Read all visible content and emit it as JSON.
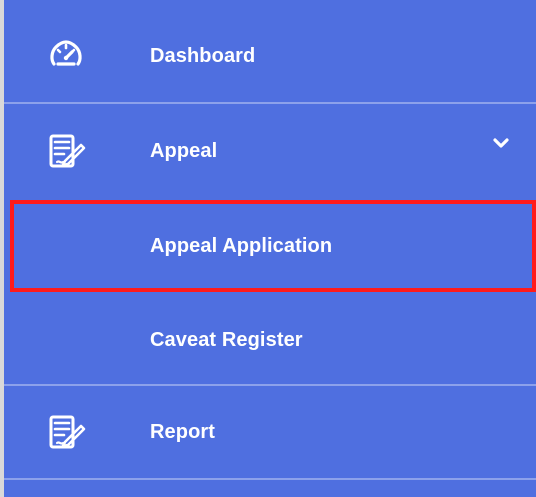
{
  "theme": {
    "background": "#4f6fe0",
    "text": "#ffffff",
    "highlight": "#ff1b1b"
  },
  "menu": {
    "items": [
      {
        "label": "Dashboard",
        "icon": "dashboard-gauge-icon"
      },
      {
        "label": "Appeal",
        "icon": "appeal-document-icon",
        "expanded": true
      },
      {
        "label": "Appeal Application",
        "level": 2,
        "highlighted": true
      },
      {
        "label": "Caveat Register",
        "level": 2
      },
      {
        "label": "Report",
        "icon": "report-document-icon"
      }
    ],
    "appeal_chevron_icon": "chevron-down-icon"
  }
}
